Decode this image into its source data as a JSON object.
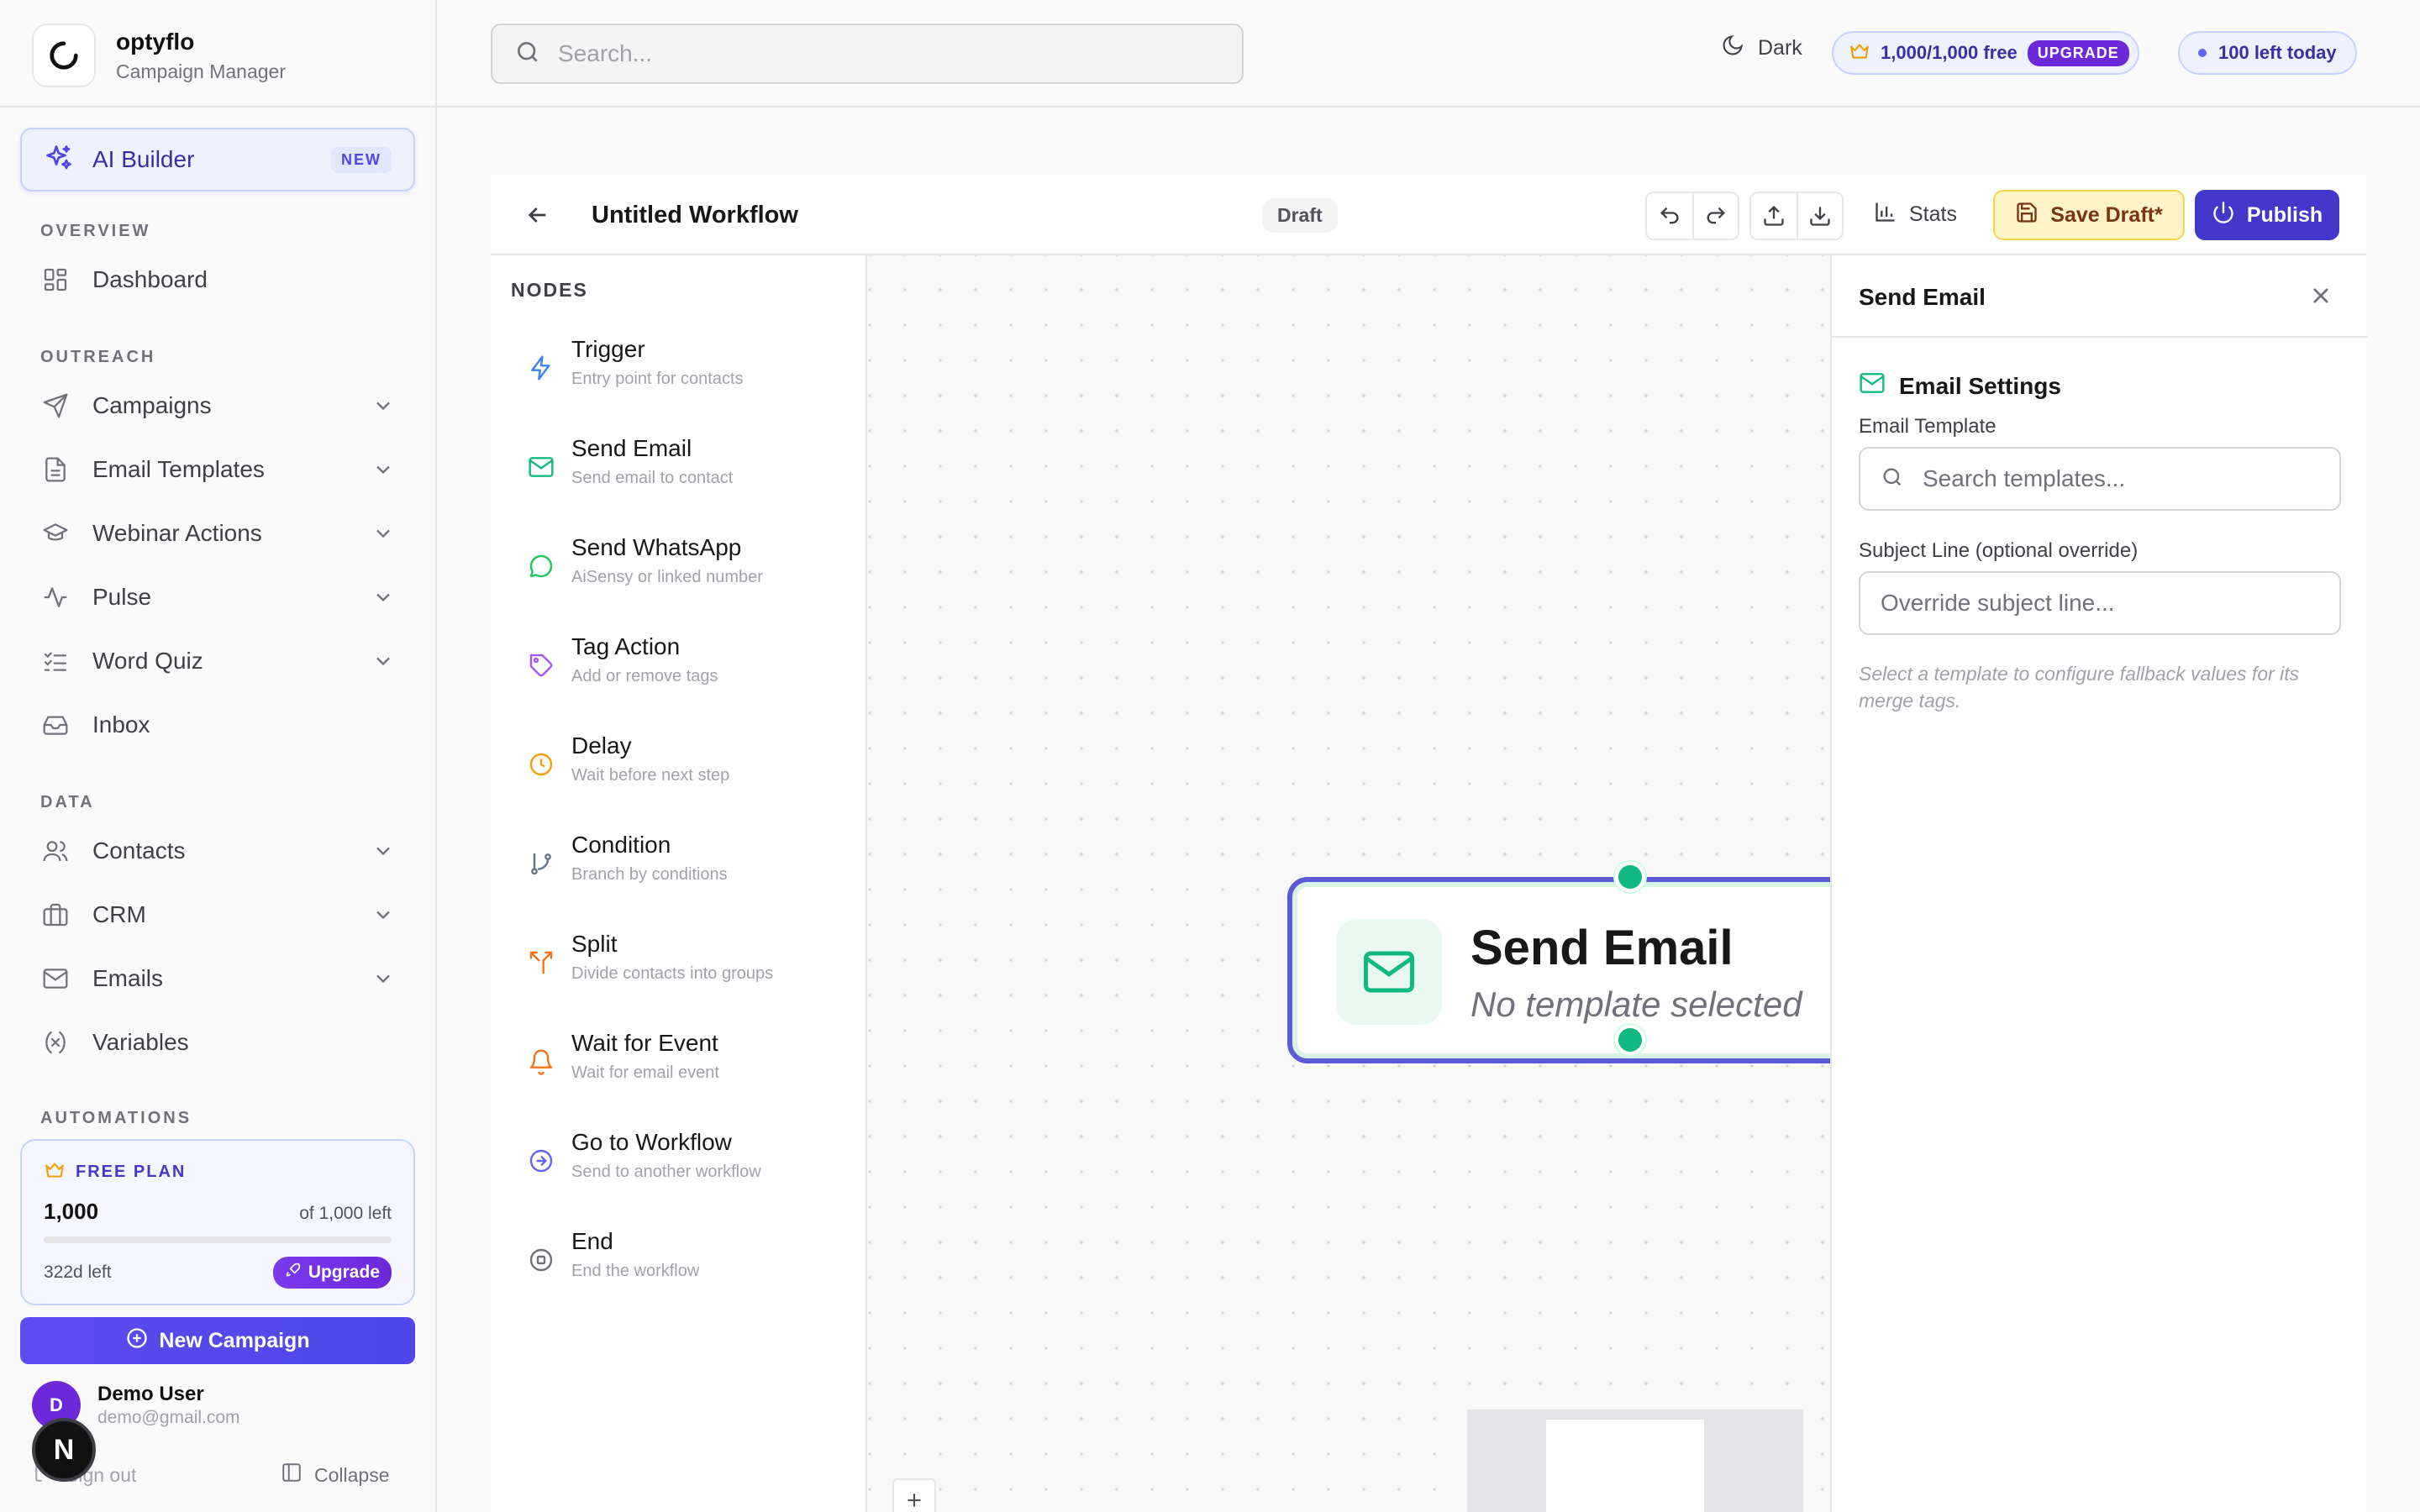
{
  "brand": {
    "name": "optyflo",
    "subtitle": "Campaign Manager"
  },
  "ai_builder": {
    "label": "AI Builder",
    "badge": "NEW"
  },
  "sidebar": {
    "sections": {
      "overview": "OVERVIEW",
      "outreach": "OUTREACH",
      "data": "DATA",
      "automations": "AUTOMATIONS"
    },
    "items": {
      "dashboard": "Dashboard",
      "campaigns": "Campaigns",
      "email_templates": "Email Templates",
      "webinar_actions": "Webinar Actions",
      "pulse": "Pulse",
      "word_quiz": "Word Quiz",
      "inbox": "Inbox",
      "contacts": "Contacts",
      "crm": "CRM",
      "emails": "Emails",
      "variables": "Variables"
    }
  },
  "plan": {
    "title": "FREE PLAN",
    "count": "1,000",
    "of_text": "of 1,000 left",
    "usage_fraction": 0,
    "days_left": "322d left",
    "upgrade_label": "Upgrade"
  },
  "new_campaign_label": "New Campaign",
  "user": {
    "initial": "D",
    "name": "Demo User",
    "email": "demo@gmail.com"
  },
  "footer": {
    "signout": "Sign out",
    "collapse": "Collapse",
    "dev_badge": "N"
  },
  "topbar": {
    "search_placeholder": "Search...",
    "dark_label": "Dark",
    "credits_text": "1,000/1,000 free",
    "upgrade_tag": "UPGRADE",
    "left_today": "100 left today"
  },
  "workflow": {
    "title": "Untitled Workflow",
    "status": "Draft",
    "stats_label": "Stats",
    "save_label": "Save Draft*",
    "publish_label": "Publish"
  },
  "nodes_panel": {
    "title": "NODES",
    "items": [
      {
        "name": "Trigger",
        "desc": "Entry point for contacts",
        "icon": "bolt-icon",
        "color": "#3b82f6"
      },
      {
        "name": "Send Email",
        "desc": "Send email to contact",
        "icon": "mail-icon",
        "color": "#10b981"
      },
      {
        "name": "Send WhatsApp",
        "desc": "AiSensy or linked number",
        "icon": "chat-bubble-icon",
        "color": "#22c55e"
      },
      {
        "name": "Tag Action",
        "desc": "Add or remove tags",
        "icon": "tag-icon",
        "color": "#a855f7"
      },
      {
        "name": "Delay",
        "desc": "Wait before next step",
        "icon": "clock-icon",
        "color": "#f59e0b"
      },
      {
        "name": "Condition",
        "desc": "Branch by conditions",
        "icon": "git-branch-icon",
        "color": "#64748b"
      },
      {
        "name": "Split",
        "desc": "Divide contacts into groups",
        "icon": "split-icon",
        "color": "#f97316"
      },
      {
        "name": "Wait for Event",
        "desc": "Wait for email event",
        "icon": "bell-icon",
        "color": "#f97316"
      },
      {
        "name": "Go to Workflow",
        "desc": "Send to another workflow",
        "icon": "arrow-circle-icon",
        "color": "#6366f1"
      },
      {
        "name": "End",
        "desc": "End the workflow",
        "icon": "stop-circle-icon",
        "color": "#71717a"
      }
    ]
  },
  "canvas_node": {
    "name": "Send Email",
    "desc": "No template selected"
  },
  "settings": {
    "title": "Send Email",
    "section": "Email Settings",
    "template_label": "Email Template",
    "template_placeholder": "Search templates...",
    "subject_label": "Subject Line (optional override)",
    "subject_placeholder": "Override subject line...",
    "help": "Select a template to configure fallback values for its merge tags."
  },
  "colors": {
    "accent": "#4f46e5",
    "brand_purple": "#6d28d9",
    "email_green": "#10b981",
    "save_amber": "#fef3c7"
  }
}
